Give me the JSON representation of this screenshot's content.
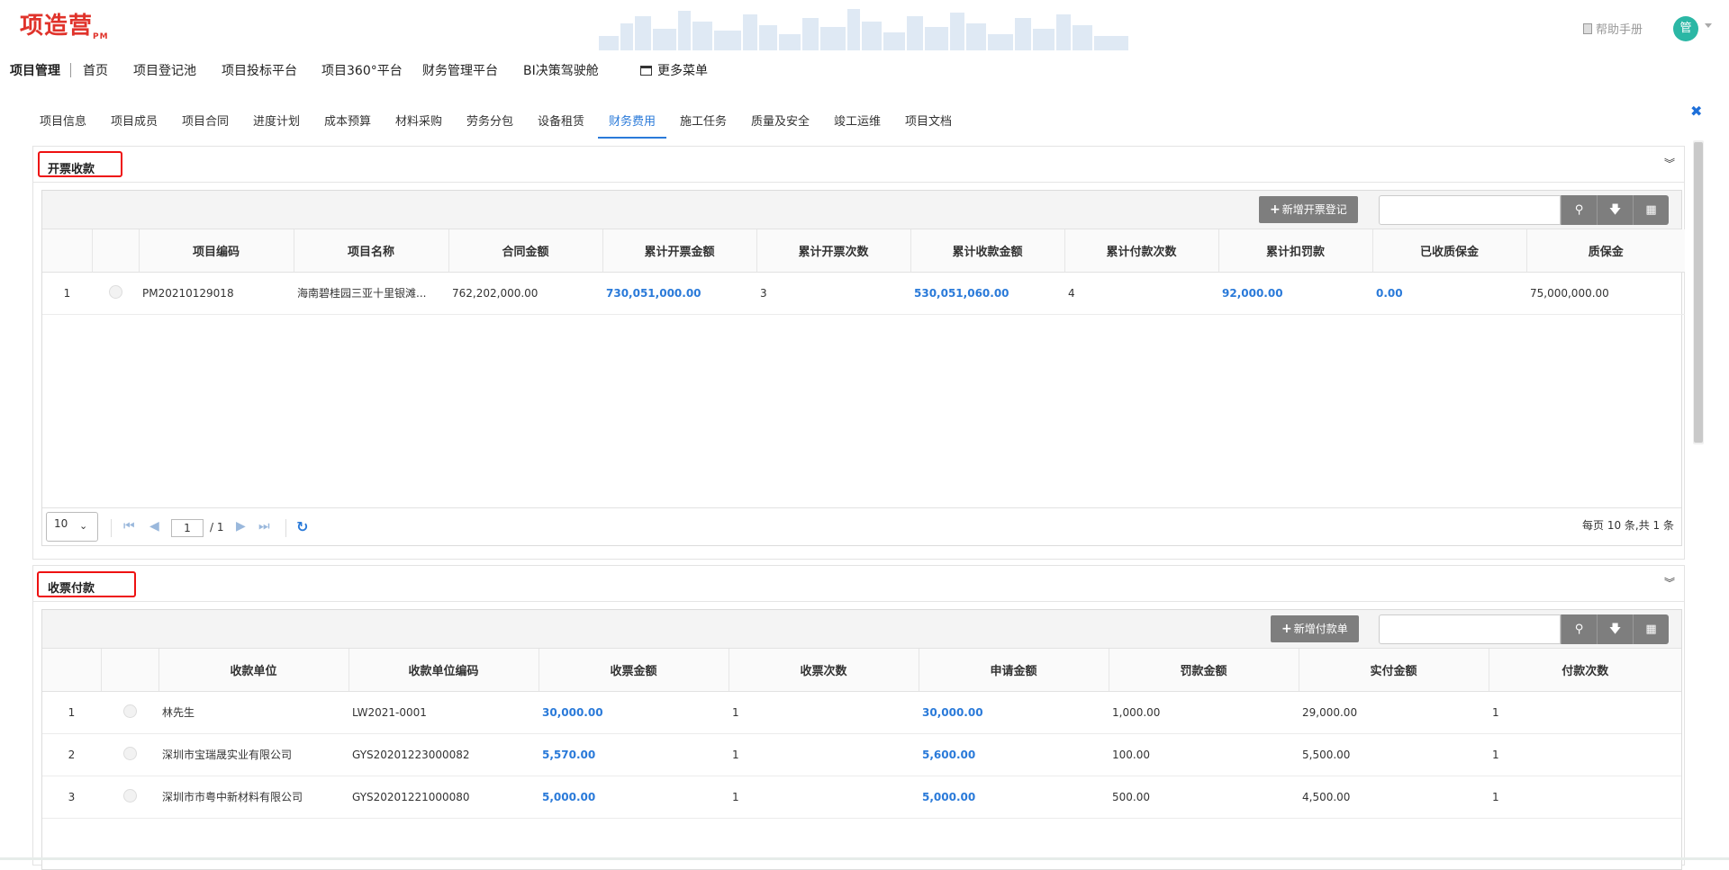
{
  "header": {
    "logo_text": "项造营",
    "logo_sub": "PM",
    "help_label": "帮助手册",
    "avatar_text": "管"
  },
  "mainnav": {
    "brand": "项目管理",
    "items": [
      "首页",
      "项目登记池",
      "项目投标平台",
      "项目360°平台",
      "财务管理平台",
      "BI决策驾驶舱"
    ],
    "more": "更多菜单"
  },
  "subtabs": {
    "items": [
      "项目信息",
      "项目成员",
      "项目合同",
      "进度计划",
      "成本预算",
      "材料采购",
      "劳务分包",
      "设备租赁",
      "财务费用",
      "施工任务",
      "质量及安全",
      "竣工运维",
      "项目文档"
    ],
    "active_index": 8
  },
  "invoice_panel": {
    "title": "开票收款",
    "add_button": "新增开票登记",
    "search_value": "",
    "columns": [
      "",
      "",
      "项目编码",
      "项目名称",
      "合同金额",
      "累计开票金额",
      "累计开票次数",
      "累计收款金额",
      "累计付款次数",
      "累计扣罚款",
      "已收质保金",
      "质保金"
    ],
    "rows": [
      {
        "no": "1",
        "code": "PM20210129018",
        "name": "海南碧桂园三亚十里银滩...",
        "contract": "762,202,000.00",
        "invoiced": "730,051,000.00",
        "invoice_count": "3",
        "received": "530,051,060.00",
        "pay_count": "4",
        "penalty": "92,000.00",
        "retention_received": "0.00",
        "retention": "75,000,000.00"
      }
    ],
    "pager": {
      "page_size": "10",
      "page": "1",
      "total_pages": "/ 1",
      "info": "每页 10 条,共 1 条"
    }
  },
  "payment_panel": {
    "title": "收票付款",
    "add_button": "新增付款单",
    "search_value": "",
    "columns": [
      "",
      "",
      "收款单位",
      "收款单位编码",
      "收票金额",
      "收票次数",
      "申请金额",
      "罚款金额",
      "实付金额",
      "付款次数"
    ],
    "rows": [
      {
        "no": "1",
        "unit": "林先生",
        "code": "LW2021-0001",
        "received_amount": "30,000.00",
        "received_count": "1",
        "apply_amount": "30,000.00",
        "penalty": "1,000.00",
        "paid": "29,000.00",
        "pay_count": "1"
      },
      {
        "no": "2",
        "unit": "深圳市宝瑞晟实业有限公司",
        "code": "GYS20201223000082",
        "received_amount": "5,570.00",
        "received_count": "1",
        "apply_amount": "5,600.00",
        "penalty": "100.00",
        "paid": "5,500.00",
        "pay_count": "1"
      },
      {
        "no": "3",
        "unit": "深圳市市粤中新材料有限公司",
        "code": "GYS20201221000080",
        "received_amount": "5,000.00",
        "received_count": "1",
        "apply_amount": "5,000.00",
        "penalty": "500.00",
        "paid": "4,500.00",
        "pay_count": "1"
      }
    ]
  },
  "colors": {
    "accent": "#2a7ad9",
    "brand_red": "#e0332b",
    "button_gray": "#7e7e7e",
    "avatar": "#2bb7a5"
  }
}
